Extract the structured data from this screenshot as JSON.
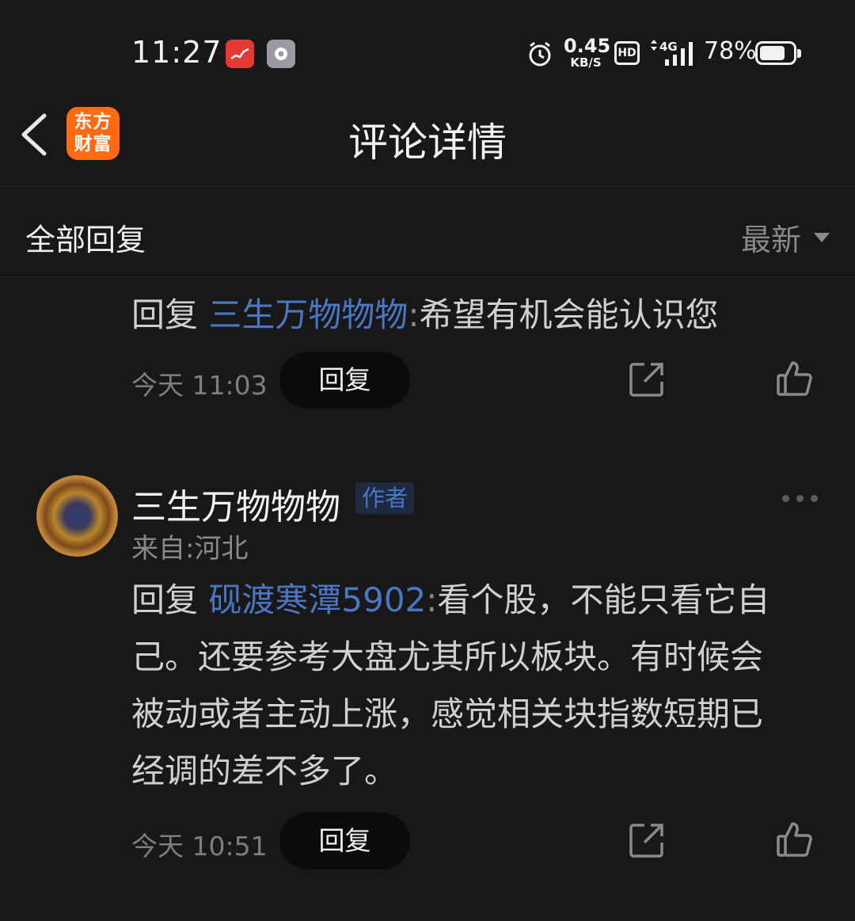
{
  "status_bar": {
    "time": "11:27",
    "net_speed_value": "0.45",
    "net_speed_unit": "KB/S",
    "hd_label": "HD",
    "network": "4G",
    "battery_percent": "78%",
    "battery_level": 0.78
  },
  "header": {
    "title": "评论详情",
    "logo_line1": "东方",
    "logo_line2": "财富",
    "brand_color": "#ff6a13"
  },
  "filter": {
    "title": "全部回复",
    "sort_label": "最新"
  },
  "comments": [
    {
      "reply_prefix": "回复",
      "mention": "三生万物物物",
      "separator": ":",
      "text": "希望有机会能认识您",
      "time": "今天 11:03",
      "reply_button": "回复"
    },
    {
      "author": "三生万物物物",
      "author_badge": "作者",
      "location": "来自:河北",
      "reply_prefix": "回复",
      "mention": "砚渡寒潭5902",
      "separator": ":",
      "text_line1": "看个股，不能只看它自",
      "text_line2": "己。还要参考大盘尤其所以板块。有时候会",
      "text_line3": "被动或者主动上涨，感觉相关块指数短期已",
      "text_line4": "经调的差不多了。",
      "time": "今天 10:51",
      "reply_button": "回复"
    }
  ],
  "colors": {
    "background": "#181818",
    "mention": "#4a76c4"
  },
  "icons": [
    "alarm-icon",
    "signal-icon",
    "back-arrow-icon",
    "share-icon",
    "like-icon",
    "more-icon"
  ]
}
